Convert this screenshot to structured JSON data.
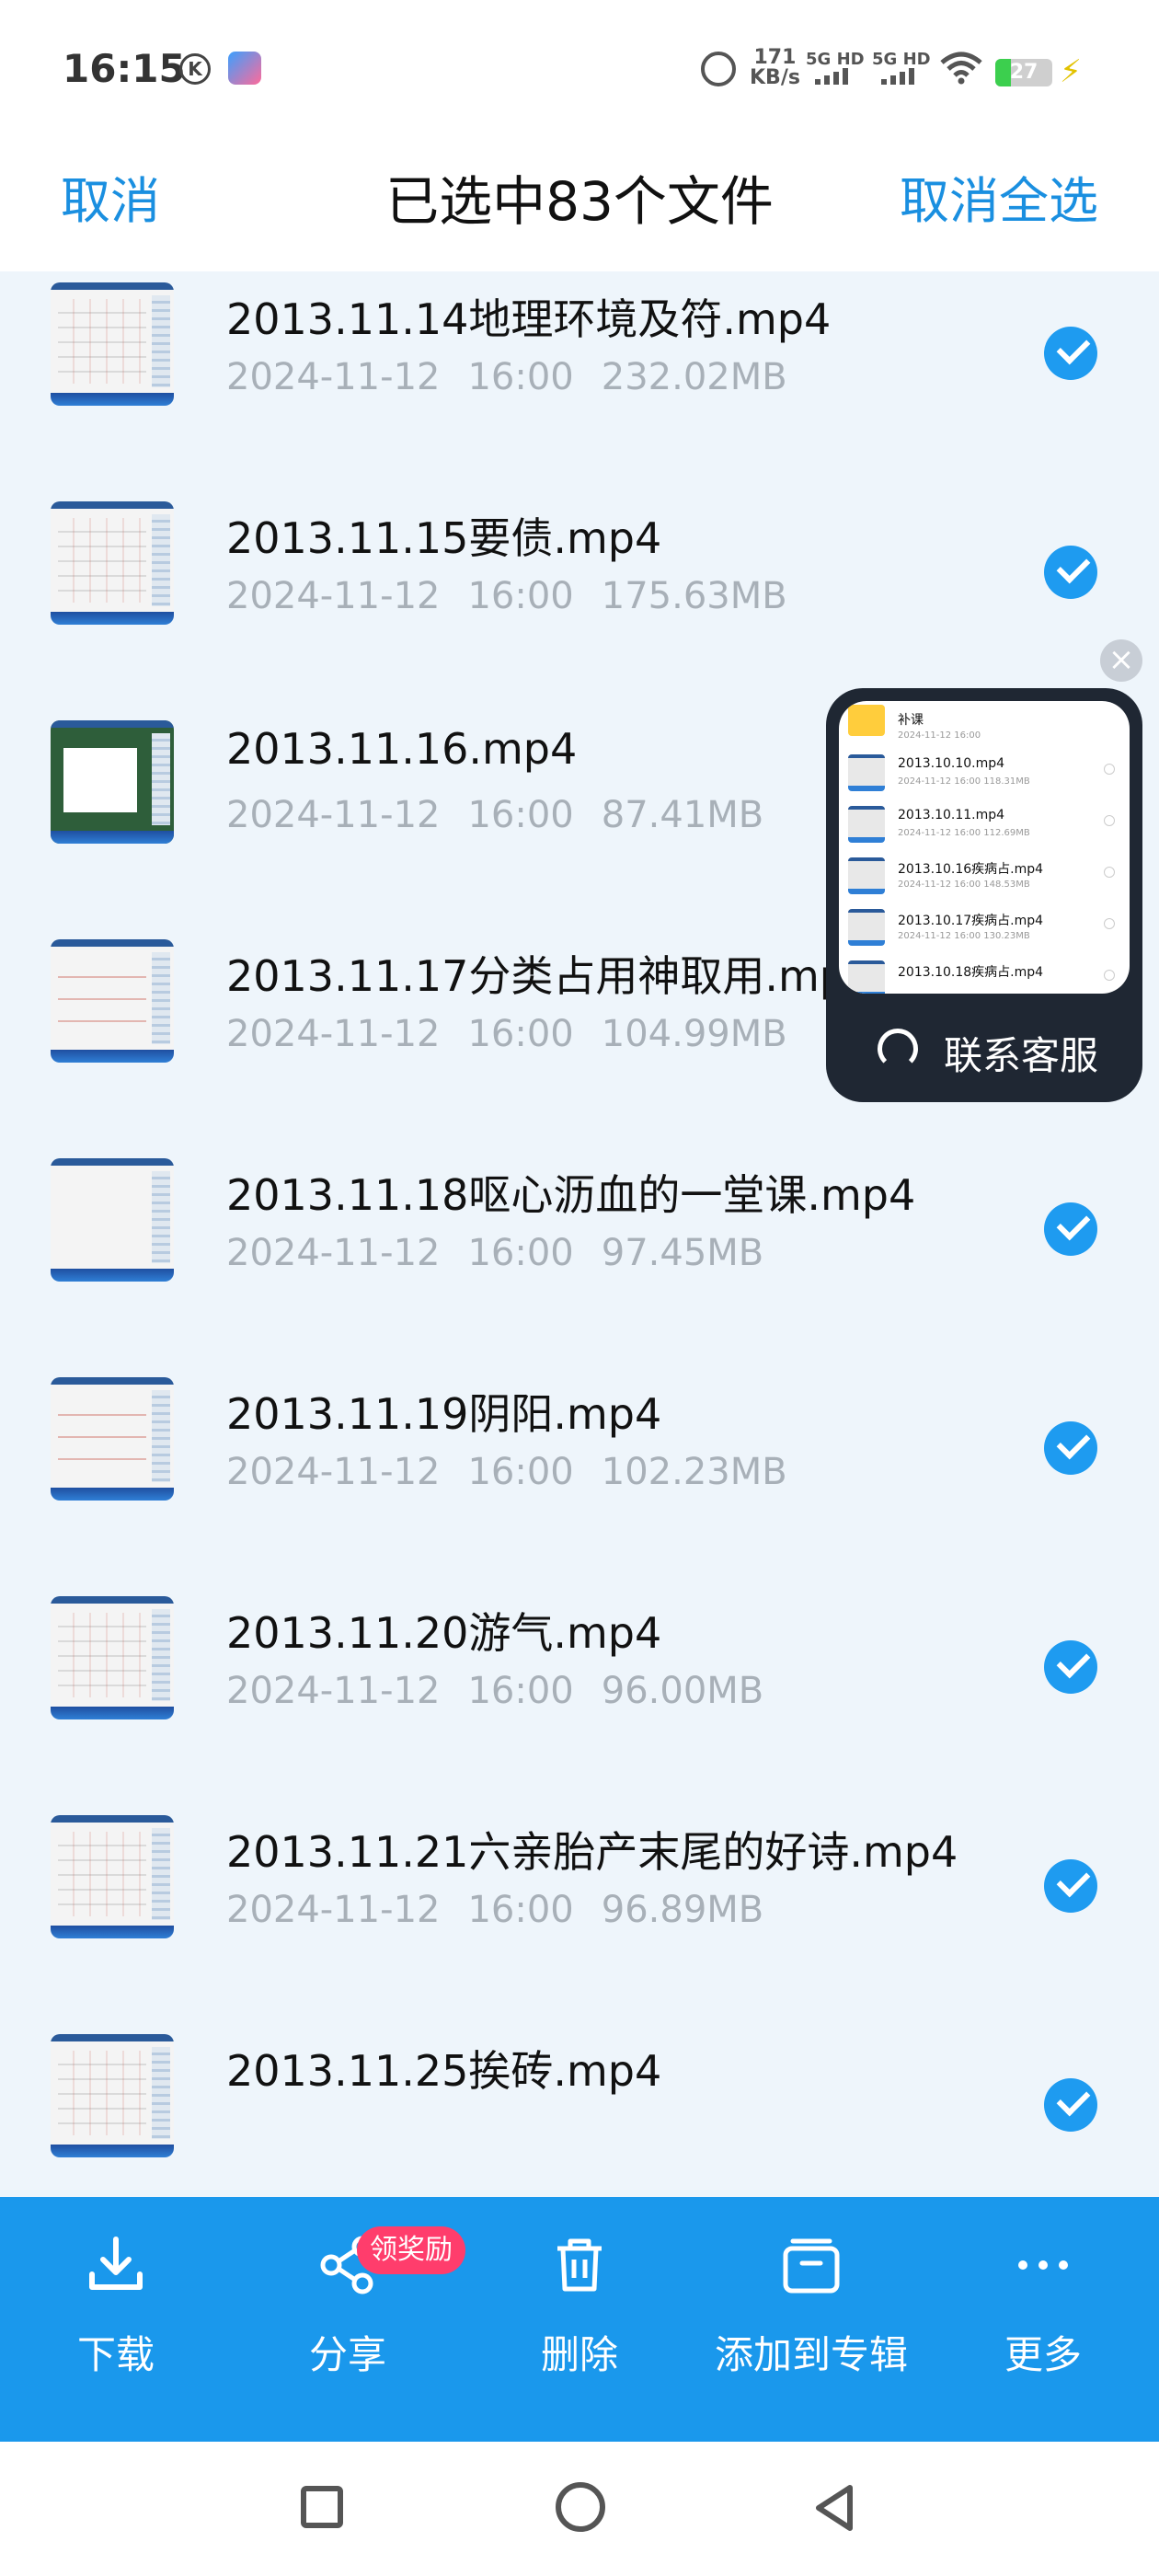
{
  "status_bar": {
    "time": "16:15",
    "k_icon": "K",
    "net_speed_value": "171",
    "net_speed_unit": "KB/s",
    "sim1": "5G HD",
    "sim2": "5G HD",
    "battery_level": "27",
    "battery_fraction": 0.27,
    "icons": [
      "k-circle-icon",
      "app-icon",
      "alarm-icon",
      "wifi-icon",
      "battery-icon",
      "charging-bolt-icon"
    ]
  },
  "header": {
    "cancel_label": "取消",
    "title": "已选中83个文件",
    "deselect_all_label": "取消全选"
  },
  "files": [
    {
      "name": "2013.11.14地理环境及符.mp4",
      "date": "2024-11-12",
      "time": "16:00",
      "size": "232.02MB",
      "checked": true
    },
    {
      "name": "2013.11.15要债.mp4",
      "date": "2024-11-12",
      "time": "16:00",
      "size": "175.63MB",
      "checked": true
    },
    {
      "name": "2013.11.16.mp4",
      "date": "2024-11-12",
      "time": "16:00",
      "size": "87.41MB",
      "checked": true
    },
    {
      "name": "2013.11.17分类占用神取用.mp4",
      "date": "2024-11-12",
      "time": "16:00",
      "size": "104.99MB",
      "checked": true
    },
    {
      "name": "2013.11.18呕心沥血的一堂课.mp4",
      "date": "2024-11-12",
      "time": "16:00",
      "size": "97.45MB",
      "checked": true
    },
    {
      "name": "2013.11.19阴阳.mp4",
      "date": "2024-11-12",
      "time": "16:00",
      "size": "102.23MB",
      "checked": true
    },
    {
      "name": "2013.11.20游气.mp4",
      "date": "2024-11-12",
      "time": "16:00",
      "size": "96.00MB",
      "checked": true
    },
    {
      "name": "2013.11.21六亲胎产末尾的好诗.mp4",
      "date": "2024-11-12",
      "time": "16:00",
      "size": "96.89MB",
      "checked": true
    },
    {
      "name": "2013.11.25挨砖.mp4",
      "date": "",
      "time": "",
      "size": "",
      "checked": true
    }
  ],
  "float_widget": {
    "close_glyph": "×",
    "preview_items": [
      {
        "name": "补课",
        "meta": "2024-11-12  16:00",
        "folder": true
      },
      {
        "name": "2013.10.10.mp4",
        "meta": "2024-11-12  16:00  118.31MB",
        "folder": false
      },
      {
        "name": "2013.10.11.mp4",
        "meta": "2024-11-12  16:00  112.69MB",
        "folder": false
      },
      {
        "name": "2013.10.16疾病占.mp4",
        "meta": "2024-11-12  16:00  148.53MB",
        "folder": false
      },
      {
        "name": "2013.10.17疾病占.mp4",
        "meta": "2024-11-12  16:00  130.23MB",
        "folder": false
      },
      {
        "name": "2013.10.18疾病占.mp4",
        "meta": "",
        "folder": false
      }
    ],
    "customer_service_label": "联系客服"
  },
  "actions": [
    {
      "label": "下载",
      "icon": "download-icon"
    },
    {
      "label": "分享",
      "icon": "share-icon"
    },
    {
      "label": "删除",
      "icon": "trash-icon"
    },
    {
      "label": "添加到专辑",
      "icon": "album-icon"
    },
    {
      "label": "更多",
      "icon": "more-icon"
    }
  ],
  "share_badge": "领奖励",
  "nav": [
    "recents-icon",
    "home-icon",
    "back-icon"
  ]
}
